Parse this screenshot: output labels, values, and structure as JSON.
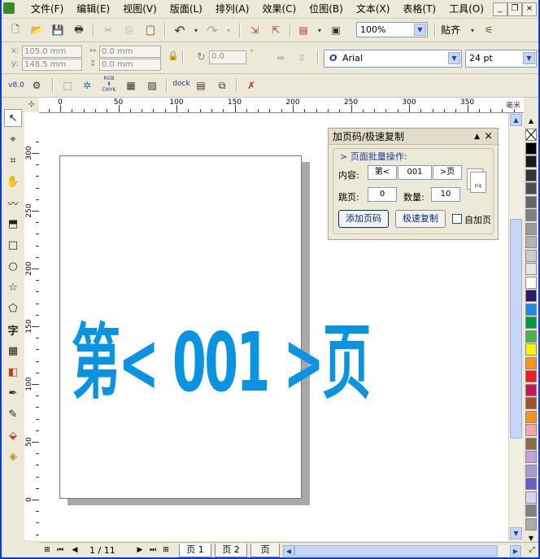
{
  "menu": [
    "文件(F)",
    "编辑(E)",
    "视图(V)",
    "版面(L)",
    "排列(A)",
    "效果(C)",
    "位图(B)",
    "文本(X)",
    "表格(T)",
    "工具(O)"
  ],
  "window_controls": {
    "minimize": "_",
    "restore": "❐",
    "close": "×"
  },
  "standard_toolbar": {
    "zoom": "100%",
    "snap_label": "贴齐"
  },
  "property_bar": {
    "x_label": "x:",
    "x_value": "105.0 mm",
    "y_label": "y:",
    "y_value": "148.5 mm",
    "w_value": "0.0 mm",
    "h_value": "0.0 mm",
    "rotation_value": "0.0",
    "degree": "°",
    "font_name": "Arial",
    "font_size": "24 pt"
  },
  "macro_toolbar": {
    "version_label": "v8.0",
    "dock_label": "dock",
    "rgb_label": "RGB",
    "cmyk_label": "CMYK"
  },
  "ruler": {
    "unit": "毫米",
    "h_labels": [
      "0",
      "50",
      "100",
      "150",
      "200",
      "250",
      "300",
      "350"
    ],
    "v_labels": [
      "300",
      "250",
      "200",
      "150",
      "100",
      "50",
      "0"
    ]
  },
  "docker": {
    "title": "加页码/极速复制",
    "group_title": "页面批量操作:",
    "content_label": "内容:",
    "prefix": "第<",
    "number": "001",
    "suffix": ">页",
    "skip_label": "跳页:",
    "skip_value": "0",
    "count_label": "数量:",
    "count_value": "10",
    "add_page_btn": "添加页码",
    "fast_copy_btn": "极速复制",
    "auto_add_label": "自加页",
    "page_icon_label": "P4"
  },
  "canvas_text": "第< 001 >页",
  "canvas_text_color": "#0a93e0",
  "status": {
    "page_counter": "1 / 11",
    "page_tabs": [
      "页 1",
      "页 2",
      "页"
    ]
  },
  "palette": [
    "#ffffff",
    "#000000",
    "#1a1a1a",
    "#333333",
    "#4d4d4d",
    "#666666",
    "#808080",
    "#999999",
    "#b3b3b3",
    "#cccccc",
    "#e6e6e6",
    "#ffffff",
    "#2a1a6e",
    "#1e88e5",
    "#009a44",
    "#4caf50",
    "#fff200",
    "#f7941d",
    "#ed1c24",
    "#c2185b",
    "#a0522d",
    "#f7941d",
    "#f4a6a6",
    "#8b6b4a",
    "#c8a0d8",
    "#a89ad4",
    "#6a5acd",
    "#e0d0f0",
    "#808080",
    "#aaaaaa"
  ]
}
